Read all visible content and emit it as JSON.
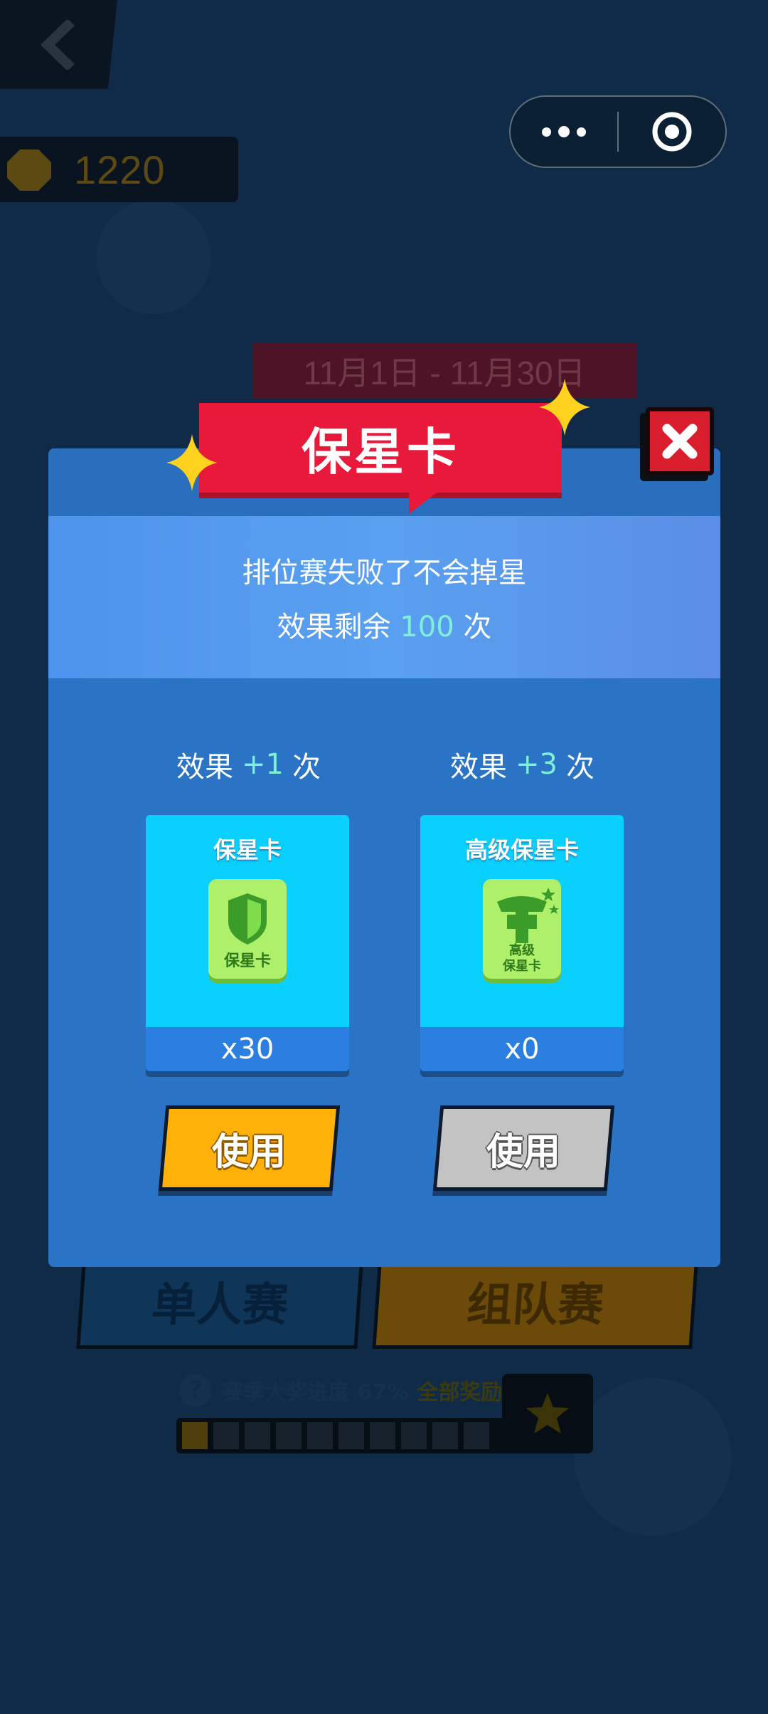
{
  "capsule": {
    "more_icon": "more-dots-icon",
    "close_icon": "target-close-icon"
  },
  "background": {
    "coins": "1220",
    "date_range": "11月1日 - 11月30日",
    "mode_solo": "单人赛",
    "mode_team": "组队赛",
    "season_progress": "赛季大奖进度 67%",
    "season_all_rewards": "全部奖励",
    "season_progress_fraction": 0.67
  },
  "modal": {
    "title": "保星卡",
    "info_line1": "排位赛失败了不会掉星",
    "info_line2_prefix": "效果剩余",
    "info_line2_count": "100",
    "info_line2_suffix": "次",
    "options": [
      {
        "effect_prefix": "效果",
        "effect_plus": "+1",
        "effect_suffix": "次",
        "card_name": "保星卡",
        "icon_text": "保星卡",
        "quantity": "x30",
        "button": "使用",
        "enabled": true
      },
      {
        "effect_prefix": "效果",
        "effect_plus": "+3",
        "effect_suffix": "次",
        "card_name": "高级保星卡",
        "icon_text_line1": "高级",
        "icon_text_line2": "保星卡",
        "quantity": "x0",
        "button": "使用",
        "enabled": false
      }
    ]
  },
  "colors": {
    "accent_red": "#e8193a",
    "card_cyan": "#09d0ff",
    "button_orange": "#ffb10a",
    "button_disabled": "#c3c3c3",
    "highlight_mint": "#7ff0d8"
  }
}
